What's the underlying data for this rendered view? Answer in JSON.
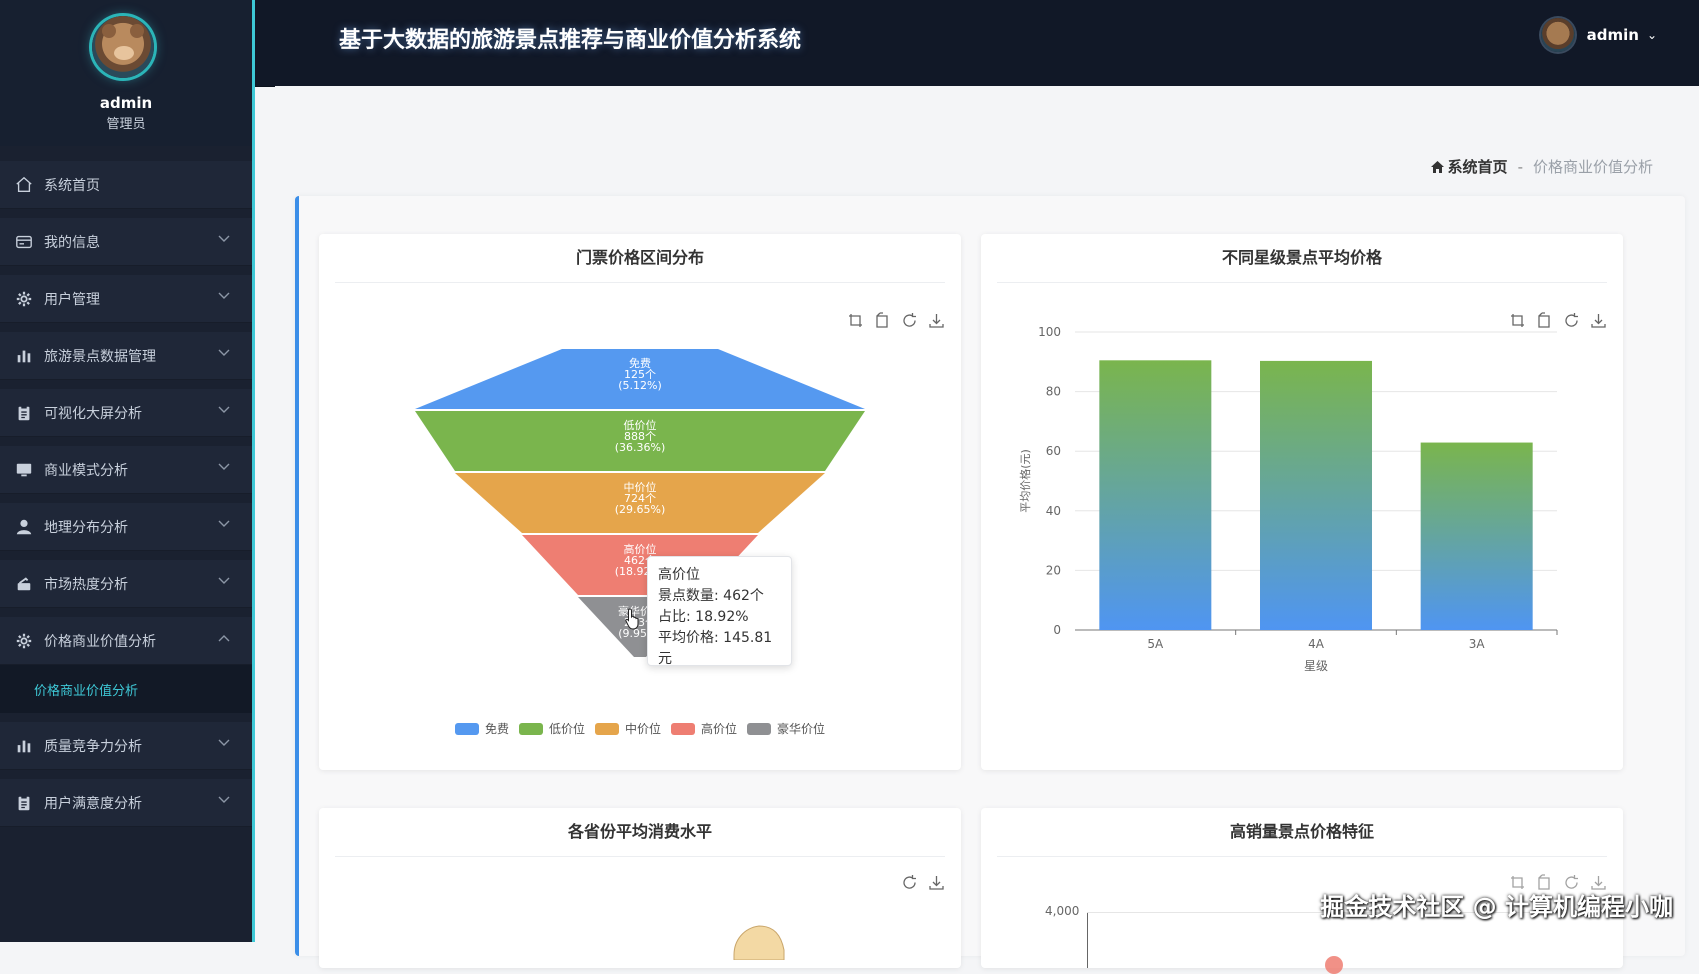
{
  "app": {
    "title": "基于大数据的旅游景点推荐与商业价值分析系统",
    "user": "admin"
  },
  "sidebar": {
    "profile": {
      "name": "admin",
      "role": "管理员"
    },
    "items": [
      {
        "label": "系统首页",
        "icon": "home-icon"
      },
      {
        "label": "我的信息",
        "icon": "id-card-icon"
      },
      {
        "label": "用户管理",
        "icon": "gear-icon"
      },
      {
        "label": "旅游景点数据管理",
        "icon": "bar-chart-icon"
      },
      {
        "label": "可视化大屏分析",
        "icon": "clipboard-icon"
      },
      {
        "label": "商业模式分析",
        "icon": "monitor-icon"
      },
      {
        "label": "地理分布分析",
        "icon": "user-icon"
      },
      {
        "label": "市场热度分析",
        "icon": "graduation-cap-icon"
      },
      {
        "label": "价格商业价值分析",
        "icon": "gear-icon"
      },
      {
        "label": "质量竞争力分析",
        "icon": "bar-chart-icon"
      },
      {
        "label": "用户满意度分析",
        "icon": "clipboard-icon"
      }
    ],
    "active_sub": "价格商业价值分析"
  },
  "breadcrumb": {
    "home": "系统首页",
    "sep": "-",
    "current": "价格商业价值分析"
  },
  "cards": {
    "funnel_title": "门票价格区间分布",
    "bar_title": "不同星级景点平均价格",
    "province_title": "各省份平均消费水平",
    "sales_title": "高销量景点价格特征"
  },
  "tooltip": {
    "name": "高价位",
    "count": "景点数量: 462个",
    "ratio": "占比: 18.92%",
    "avg": "平均价格: 145.81元"
  },
  "watermark": "掘金技术社区 @ 计算机编程小咖",
  "sales_axis_top": "4,000",
  "chart_data": [
    {
      "type": "funnel",
      "title": "门票价格区间分布",
      "categories": [
        "免费",
        "低价位",
        "中价位",
        "高价位",
        "豪华价位"
      ],
      "values": [
        125,
        888,
        724,
        462,
        243
      ],
      "percents": [
        "5.12%",
        "36.36%",
        "29.65%",
        "18.92%",
        "9.95%"
      ],
      "colors": [
        "#5599f0",
        "#7ab54d",
        "#e5a54b",
        "#ee7e72",
        "#8f9093"
      ],
      "value_suffix": "个",
      "legend": "bottom"
    },
    {
      "type": "bar",
      "title": "不同星级景点平均价格",
      "categories": [
        "5A",
        "4A",
        "3A"
      ],
      "values": [
        90.5,
        90.3,
        62.9
      ],
      "xlabel": "星级",
      "ylabel": "平均价格(元)",
      "ylim": [
        0,
        100
      ],
      "yticks": [
        0,
        20,
        40,
        60,
        80,
        100
      ],
      "gradient": [
        "#7ab54d",
        "#4f95f2"
      ]
    }
  ]
}
